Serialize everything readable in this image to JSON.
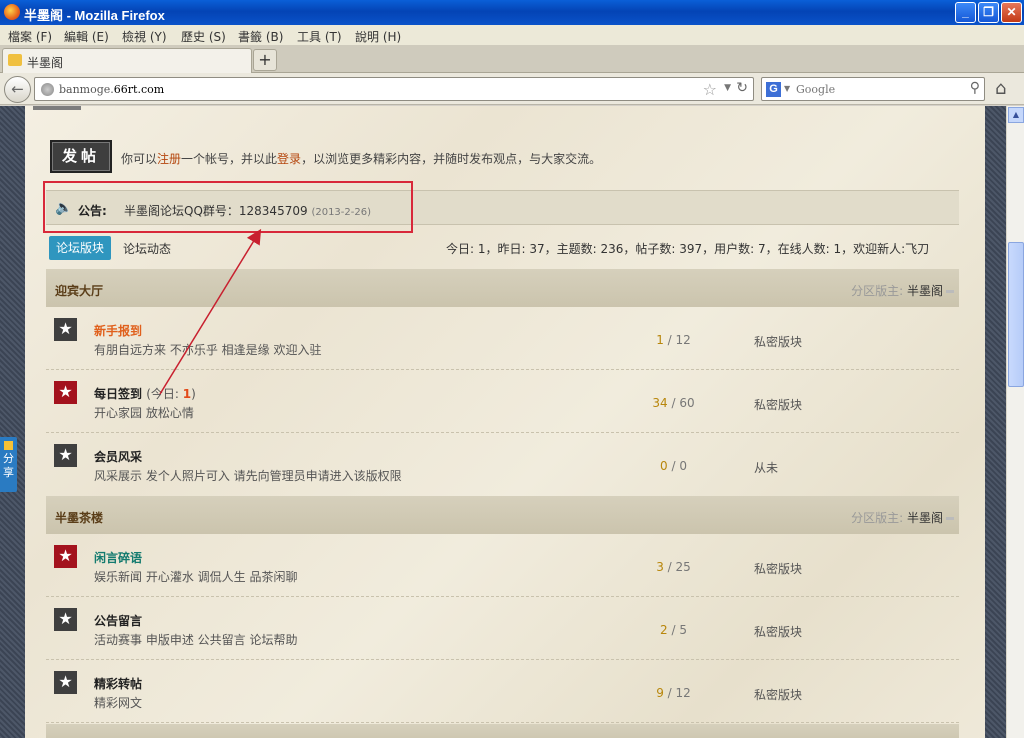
{
  "window": {
    "title": "半墨阁 - Mozilla Firefox",
    "minimize": "_",
    "maximize": "❐",
    "close": "✕"
  },
  "menu": [
    "檔案 (F)",
    "編輯 (E)",
    "檢視 (Y)",
    "歷史 (S)",
    "書籤 (B)",
    "工具 (T)",
    "說明 (H)"
  ],
  "tab": {
    "label": "半墨阁",
    "new_tab": "+"
  },
  "nav": {
    "url_host_prefix": "banmoge.",
    "url_host_main": "66rt.com",
    "search_placeholder": "Google",
    "search_engine_icon": "G"
  },
  "page": {
    "post_button": "发帖",
    "intro_before": "你可以",
    "intro_register": "注册",
    "intro_mid": "一个帐号，并以此",
    "intro_login": "登录",
    "intro_after": "，以浏览更多精彩内容，并随时发布观点，与大家交流。",
    "notice_label": "公告:",
    "notice_text": "半墨阁论坛QQ群号：128345709",
    "notice_date": "(2013-2-26)",
    "tab_forums": "论坛版块",
    "tab_dynamics": "论坛动态",
    "stats": "今日: 1，昨日: 37，主题数: 236，帖子数: 397，用户数: 7，在线人数: 1，欢迎新人:飞刀",
    "share_label": "分享",
    "moderator_label": "分区版主:",
    "sections": [
      {
        "title": "迎宾大厅",
        "moderator": "半墨阁",
        "forums": [
          {
            "name": "新手报到",
            "desc": "有朋自远方来 不亦乐乎 相逢是缘 欢迎入驻",
            "threads": "1",
            "posts": "12",
            "last": "私密版块",
            "today": ""
          },
          {
            "name": "每日签到",
            "desc": "开心家园 放松心情",
            "threads": "34",
            "posts": "60",
            "last": "私密版块",
            "today": "1",
            "today_label": "(今日: ",
            "today_close": ")"
          },
          {
            "name": "会员风采",
            "desc": "风采展示 发个人照片可入 请先向管理员申请进入该版权限",
            "threads": "0",
            "posts": "0",
            "last": "从未",
            "today": ""
          }
        ]
      },
      {
        "title": "半墨茶楼",
        "moderator": "半墨阁",
        "forums": [
          {
            "name": "闲言碎语",
            "desc": "娱乐新闻 开心灌水 调侃人生 品茶闲聊",
            "threads": "3",
            "posts": "25",
            "last": "私密版块",
            "today": ""
          },
          {
            "name": "公告留言",
            "desc": "活动赛事 申版申述 公共留言 论坛帮助",
            "threads": "2",
            "posts": "5",
            "last": "私密版块",
            "today": ""
          },
          {
            "name": "精彩转帖",
            "desc": "精彩网文",
            "threads": "9",
            "posts": "12",
            "last": "私密版块",
            "today": ""
          }
        ]
      }
    ]
  },
  "colors": {
    "accent_red": "#d8283a",
    "tab_blue": "#2f96bf",
    "link_orange": "#b5470f",
    "highlight_red": "#e24a1a"
  },
  "icons": {
    "forum_icon": "star-icon",
    "notice_icon": "speaker-icon",
    "back": "back-arrow-icon",
    "home": "home-icon"
  }
}
